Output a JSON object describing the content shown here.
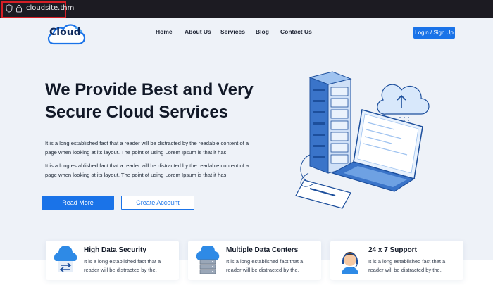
{
  "browser": {
    "url": "cloudsite.thm"
  },
  "logo": {
    "text": "Cloud"
  },
  "nav": {
    "items": [
      "Home",
      "About Us",
      "Services",
      "Blog",
      "Contact Us"
    ],
    "login_label": "Login / Sign Up"
  },
  "hero": {
    "title_line1": "We Provide Best and Very",
    "title_line2": "Secure Cloud Services",
    "paragraph1": "It is a long established fact that a reader will be distracted by the readable content of a page when looking at its layout. The point of using Lorem Ipsum is that it has.",
    "paragraph2": "It is a long established fact that a reader will be distracted by the readable content of a page when looking at its layout. The point of using Lorem Ipsum is that it has.",
    "read_more_label": "Read More",
    "create_account_label": "Create Account"
  },
  "features": [
    {
      "title": "High Data Security",
      "desc": "It is a long established fact that a reader will be distracted by the.",
      "icon": "cloud-transfer-icon"
    },
    {
      "title": "Multiple Data Centers",
      "desc": "It is a long established fact that a reader will be distracted by the.",
      "icon": "cloud-server-icon"
    },
    {
      "title": "24 x 7 Support",
      "desc": "It is a long established fact that a reader will be distracted by the.",
      "icon": "support-agent-icon"
    }
  ],
  "colors": {
    "accent": "#1a73e8",
    "background": "#eef2f8",
    "text_dark": "#111827",
    "url_highlight": "#d61f26"
  }
}
